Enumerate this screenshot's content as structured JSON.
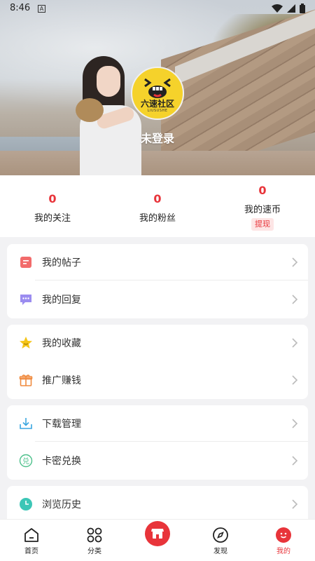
{
  "status_bar": {
    "time": "8:46",
    "notification_letter": "A"
  },
  "profile": {
    "login_text": "未登录",
    "avatar_brand": "六速社区",
    "avatar_brand_sub": "LIUSUSHE"
  },
  "stats": [
    {
      "value": "0",
      "label": "我的关注"
    },
    {
      "value": "0",
      "label": "我的粉丝"
    },
    {
      "value": "0",
      "label": "我的速币"
    }
  ],
  "withdraw_label": "提现",
  "menu": {
    "group1": [
      {
        "label": "我的帖子",
        "icon": "post-icon"
      },
      {
        "label": "我的回复",
        "icon": "reply-icon"
      }
    ],
    "group2": [
      {
        "label": "我的收藏",
        "icon": "star-icon"
      },
      {
        "label": "推广赚钱",
        "icon": "gift-icon"
      }
    ],
    "group3": [
      {
        "label": "下载管理",
        "icon": "download-icon"
      },
      {
        "label": "卡密兑换",
        "icon": "redeem-icon"
      }
    ],
    "group4": [
      {
        "label": "浏览历史",
        "icon": "clock-icon"
      }
    ]
  },
  "bottom_nav": [
    {
      "label": "首页",
      "icon": "home-icon"
    },
    {
      "label": "分类",
      "icon": "grid-icon"
    },
    {
      "label": "",
      "icon": "store-icon"
    },
    {
      "label": "发现",
      "icon": "compass-icon"
    },
    {
      "label": "我的",
      "icon": "profile-icon",
      "active": true
    }
  ],
  "colors": {
    "accent": "#e8343a",
    "avatar_yellow": "#f5d22b",
    "background": "#f2f2f4"
  }
}
